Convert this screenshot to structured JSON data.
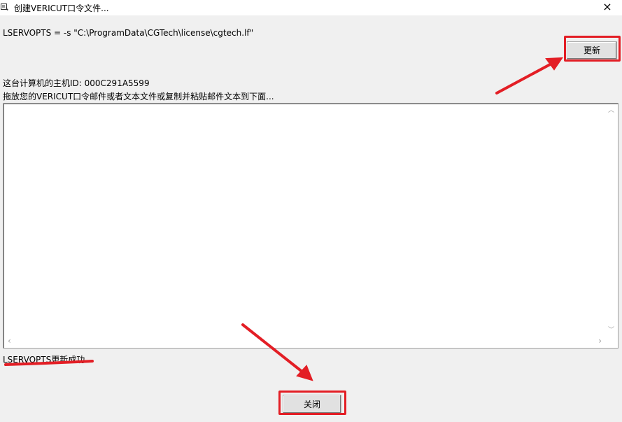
{
  "window": {
    "title": "创建VERICUT口令文件...",
    "close_glyph": "×"
  },
  "lservopts_line": "LSERVOPTS = -s \"C:\\ProgramData\\CGTech\\license\\cgtech.lf\"",
  "update_button": {
    "label": "更新"
  },
  "host_id_line": "这台计算机的主机ID: 000C291A5599",
  "instruction_line": "拖放您的VERICUT口令邮件或者文本文件或复制并粘贴邮件文本到下面...",
  "paste_area": {
    "value": ""
  },
  "status_message": "LSERVOPTS更新成功",
  "close_button": {
    "label": "关闭"
  },
  "scroll_glyphs": {
    "up": "︿",
    "down": "﹀",
    "left": "‹",
    "right": "›"
  },
  "colors": {
    "annotation_red": "#e31e25",
    "window_bg": "#f0f0f0",
    "button_face": "#e1e1e1"
  },
  "icons": [
    "app-icon",
    "close-icon",
    "scroll-up-arrow-icon",
    "scroll-down-arrow-icon",
    "scroll-left-arrow-icon",
    "scroll-right-arrow-icon"
  ]
}
